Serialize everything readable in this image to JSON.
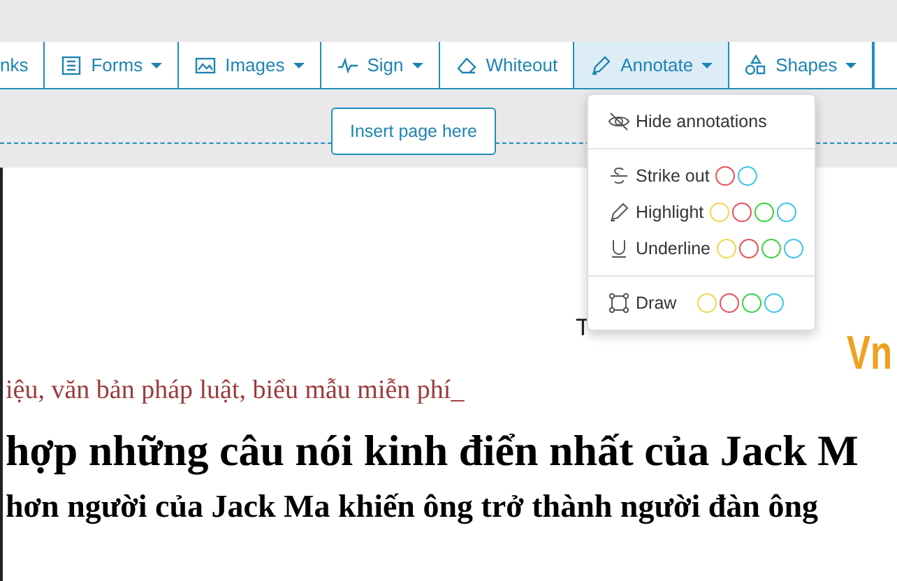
{
  "toolbar": {
    "buttons": [
      {
        "label": "nks",
        "caret": false,
        "selected": false
      },
      {
        "label": "Forms",
        "caret": true,
        "selected": false
      },
      {
        "label": "Images",
        "caret": true,
        "selected": false
      },
      {
        "label": "Sign",
        "caret": true,
        "selected": false
      },
      {
        "label": "Whiteout",
        "caret": false,
        "selected": false
      },
      {
        "label": "Annotate",
        "caret": true,
        "selected": true
      },
      {
        "label": "Shapes",
        "caret": true,
        "selected": false
      }
    ]
  },
  "insert_page": {
    "label": "Insert page here"
  },
  "annotate_menu": {
    "sections": [
      [
        {
          "label": "Hide annotations"
        }
      ],
      [
        {
          "label": "Strike out",
          "colors": [
            {
              "color": "#e8505b"
            },
            {
              "color": "#3ec3e8"
            }
          ]
        },
        {
          "label": "Highlight",
          "colors": [
            {
              "color": "#f0d84a"
            },
            {
              "color": "#e8505b"
            },
            {
              "color": "#3ed23e"
            },
            {
              "color": "#3ec3e8"
            }
          ]
        },
        {
          "label": "Underline",
          "colors": [
            {
              "color": "#f0d84a"
            },
            {
              "color": "#e8505b"
            },
            {
              "color": "#3ed23e"
            },
            {
              "color": "#3ec3e8"
            }
          ]
        }
      ],
      [
        {
          "label": "Draw",
          "colors": [
            {
              "color": "#f0d84a"
            },
            {
              "color": "#e8505b"
            },
            {
              "color": "#3ed23e"
            },
            {
              "color": "#3ec3e8"
            }
          ]
        }
      ]
    ]
  },
  "document": {
    "partial_text": "T",
    "logo": "Vn",
    "subtitle": "iệu, văn bản pháp luật, biểu mẫu miễn phí_",
    "heading": "hợp những câu nói kinh điển nhất của Jack M",
    "lead": "hơn người của Jack Ma khiến ông trở thành người đàn ông"
  }
}
